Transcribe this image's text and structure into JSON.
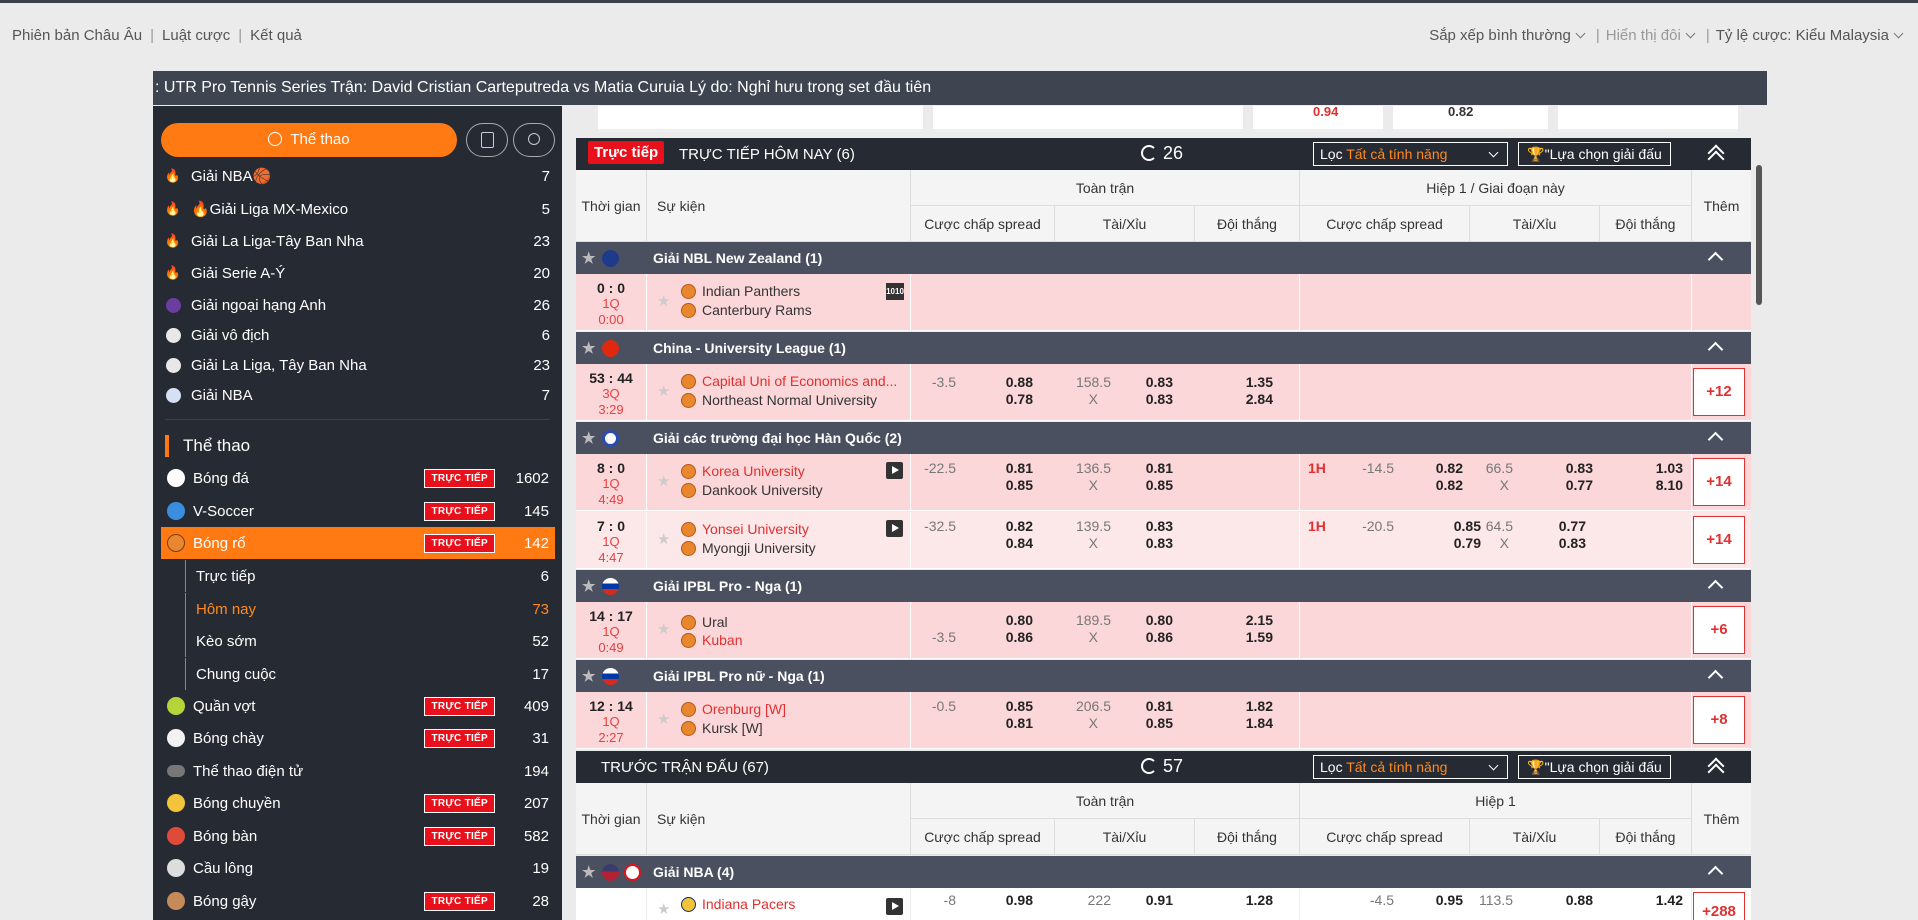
{
  "top": {
    "links": [
      "Phiên bản Châu Âu",
      "Luật cược",
      "Kết quả"
    ],
    "sort": "Sắp xếp bình thường",
    "display": "Hiển thị đôi",
    "odds_label": "Tỷ lệ cược:",
    "odds_value": "Kiểu Malaysia"
  },
  "ticker": ": UTR Pro Tennis Series Trận: David Cristian Carteputreda vs Matia Curuia Lý do: Nghỉ hưu trong set đầu tiên",
  "sidebar": {
    "tab": "Thể thao",
    "favorites": [
      {
        "name": "Giải NBA🏀",
        "count": "7",
        "icon": "flame-icon"
      },
      {
        "name": "🔥Giải Liga MX-Mexico",
        "count": "5",
        "icon": "flame-icon"
      },
      {
        "name": "Giải La Liga-Tây Ban Nha",
        "count": "23",
        "icon": "flame-icon"
      },
      {
        "name": "Giải Serie A-Ý",
        "count": "20",
        "icon": "flame-icon"
      },
      {
        "name": "Giải ngoại hạng Anh",
        "count": "26",
        "icon": "league-logo-icon"
      },
      {
        "name": "Giải vô địch",
        "count": "6",
        "icon": "league-logo-icon"
      },
      {
        "name": "Giải La Liga, Tây Ban Nha",
        "count": "23",
        "icon": "league-logo-icon"
      },
      {
        "name": "Giải NBA",
        "count": "7",
        "icon": "league-logo-icon"
      }
    ],
    "section": "Thể thao",
    "live_label": "TRỰC TIẾP",
    "sports": [
      {
        "name": "Bóng đá",
        "live": true,
        "count": "1602",
        "color": "#ffffff"
      },
      {
        "name": "V-Soccer",
        "live": true,
        "count": "145",
        "color": "#3b8de0"
      },
      {
        "name": "Bóng rổ",
        "live": true,
        "count": "142",
        "color": "#e8872d"
      },
      {
        "name": "Quần vợt",
        "live": true,
        "count": "409",
        "color": "#b6d43a"
      },
      {
        "name": "Bóng chày",
        "live": true,
        "count": "31",
        "color": "#f2f2f2"
      },
      {
        "name": "Thể thao điện tử",
        "live": false,
        "count": "194",
        "color": "#777777"
      },
      {
        "name": "Bóng chuyền",
        "live": true,
        "count": "207",
        "color": "#f3c43a"
      },
      {
        "name": "Bóng bàn",
        "live": true,
        "count": "582",
        "color": "#e04a3a"
      },
      {
        "name": "Cầu lông",
        "live": false,
        "count": "19",
        "color": "#dddddd"
      },
      {
        "name": "Bóng gậy",
        "live": true,
        "count": "28",
        "color": "#c58a5a"
      }
    ],
    "subs": [
      {
        "name": "Trực tiếp",
        "count": "6"
      },
      {
        "name": "Hôm nay",
        "count": "73"
      },
      {
        "name": "Kèo sớm",
        "count": "52"
      },
      {
        "name": "Chung cuộc",
        "count": "17"
      }
    ]
  },
  "main": {
    "scroll_nums": [
      "0.94",
      "0.82"
    ],
    "live": {
      "badge": "Trực tiếp",
      "title": "TRỰC TIẾP HÔM NAY (6)",
      "refresh": "26"
    },
    "pre": {
      "title": "TRƯỚC TRẬN ĐẤU (67)",
      "refresh": "57"
    },
    "filter": {
      "label": "Lọc",
      "value": "Tất cả tính năng"
    },
    "pick": "\"Lựa chọn giải đấu",
    "cols": {
      "time": "Thời gian",
      "event": "Sự kiện",
      "full": "Toàn trận",
      "half_live": "Hiệp 1 / Giai đoạn này",
      "half_pre": "Hiệp 1",
      "spread": "Cược chấp spread",
      "ou": "Tài/Xỉu",
      "winner": "Đội thắng",
      "more": "Thêm"
    },
    "x": "X",
    "h1": "1H",
    "leagues": [
      "Giải NBL New Zealand (1)",
      "China - University League (1)",
      "Giải các trường đại học Hàn Quốc (2)",
      "Giải IPBL Pro - Nga (1)",
      "Giải IPBL Pro nữ - Nga (1)",
      "Giải NBA (4)"
    ],
    "m1": {
      "score": "0 : 0",
      "q": "1Q",
      "t": "0:00",
      "home": "Indian Panthers",
      "away": "Canterbury Rams",
      "stat": "1010"
    },
    "m2": {
      "score": "53 : 44",
      "q": "3Q",
      "t": "3:29",
      "home": "Capital Uni of Economics and...",
      "away": "Northeast Normal University",
      "sp": "-3.5",
      "sp1": "0.88",
      "sp2": "0.78",
      "ou": "158.5",
      "ou1": "0.83",
      "ou2": "0.83",
      "w1": "1.35",
      "w2": "2.84",
      "more": "+12"
    },
    "m3": {
      "score": "8 : 0",
      "q": "1Q",
      "t": "4:49",
      "home": "Korea University",
      "away": "Dankook University",
      "sp": "-22.5",
      "sp1": "0.81",
      "sp2": "0.85",
      "ou": "136.5",
      "ou1": "0.81",
      "ou2": "0.85",
      "hsp": "-14.5",
      "hsp1": "0.82",
      "hsp2": "0.82",
      "hou": "66.5",
      "hou1": "0.83",
      "hou2": "0.77",
      "hw1": "1.03",
      "hw2": "8.10",
      "more": "+14"
    },
    "m4": {
      "score": "7 : 0",
      "q": "1Q",
      "t": "4:47",
      "home": "Yonsei University",
      "away": "Myongji University",
      "sp": "-32.5",
      "sp1": "0.82",
      "sp2": "0.84",
      "ou": "139.5",
      "ou1": "0.83",
      "ou2": "0.83",
      "hsp": "-20.5",
      "hsp1": "0.85",
      "hsp2": "0.79",
      "hou": "64.5",
      "hou1": "0.77",
      "hou2": "0.83",
      "more": "+14"
    },
    "m5": {
      "score": "14 : 17",
      "q": "1Q",
      "t": "0:49",
      "home": "Ural",
      "away": "Kuban",
      "sp": "-3.5",
      "sp1": "0.80",
      "sp2": "0.86",
      "ou": "189.5",
      "ou1": "0.80",
      "ou2": "0.86",
      "w1": "2.15",
      "w2": "1.59",
      "more": "+6"
    },
    "m6": {
      "score": "12 : 14",
      "q": "1Q",
      "t": "2:27",
      "home": "Orenburg [W]",
      "away": "Kursk [W]",
      "sp": "-0.5",
      "sp1": "0.85",
      "sp2": "0.81",
      "ou": "206.5",
      "ou1": "0.81",
      "ou2": "0.85",
      "w1": "1.82",
      "w2": "1.84",
      "more": "+8"
    },
    "m7": {
      "home": "Indiana Pacers",
      "sp": "-8",
      "sp1": "0.98",
      "ou": "222",
      "ou1": "0.91",
      "w1": "1.28",
      "hsp": "-4.5",
      "hsp1": "0.95",
      "hou": "113.5",
      "hou1": "0.88",
      "hw1": "1.42",
      "more": "+288"
    }
  }
}
